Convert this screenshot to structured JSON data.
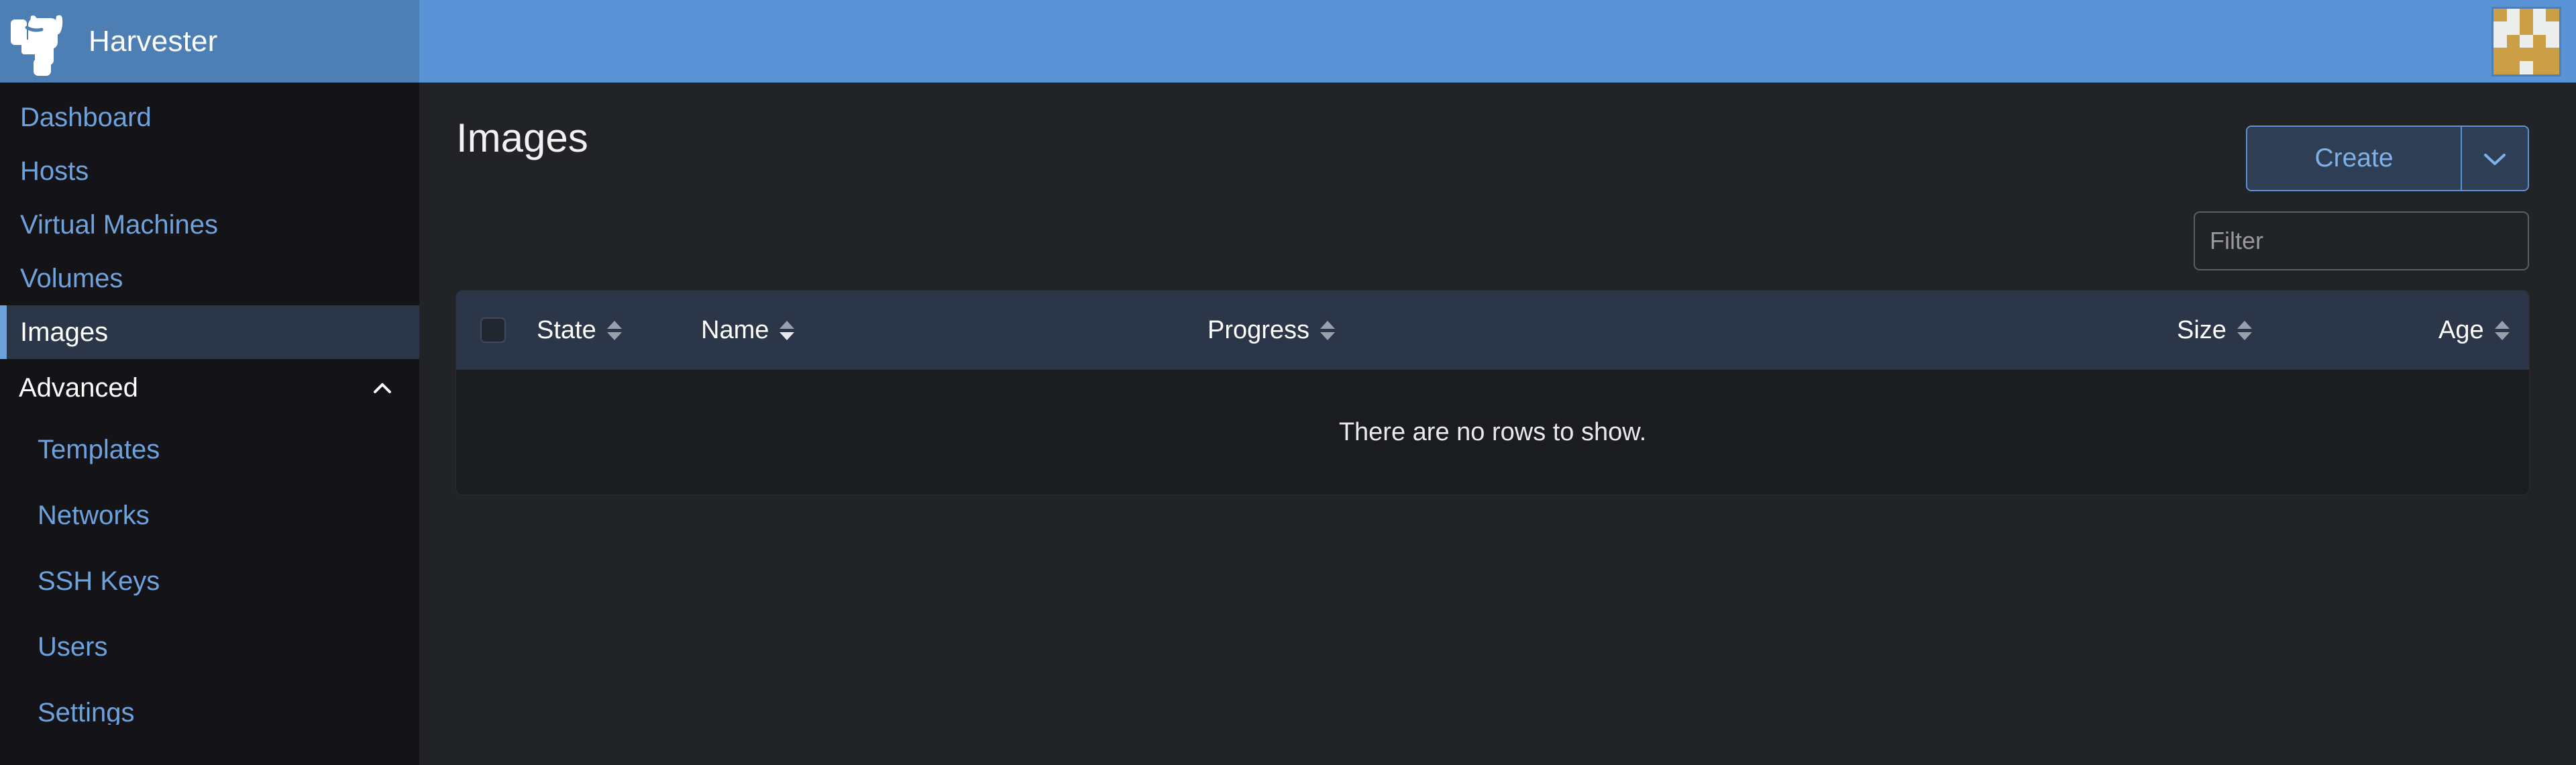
{
  "brand": {
    "title": "Harvester",
    "logo_icon": "harvester-bull-logo",
    "header_color": "#4d7fb5"
  },
  "topbar": {
    "background_color": "#5b94d6",
    "avatar_icon": "user-identicon-avatar",
    "identicon_color": "#cb9f46",
    "identicon_grid": [
      [
        1,
        0,
        1,
        0,
        1
      ],
      [
        0,
        0,
        1,
        0,
        0
      ],
      [
        0,
        1,
        0,
        1,
        0
      ],
      [
        1,
        1,
        1,
        1,
        1
      ],
      [
        1,
        1,
        0,
        1,
        1
      ]
    ]
  },
  "sidebar": {
    "items": [
      {
        "label": "Dashboard",
        "selected": false
      },
      {
        "label": "Hosts",
        "selected": false
      },
      {
        "label": "Virtual Machines",
        "selected": false
      },
      {
        "label": "Volumes",
        "selected": false
      },
      {
        "label": "Images",
        "selected": true
      }
    ],
    "group": {
      "label": "Advanced",
      "expanded": true,
      "chevron_icon": "chevron-up-icon",
      "items": [
        {
          "label": "Templates"
        },
        {
          "label": "Networks"
        },
        {
          "label": "SSH Keys"
        },
        {
          "label": "Users"
        },
        {
          "label": "Settings"
        }
      ]
    },
    "link_color": "#6ea2dd",
    "selected_bg": "#2b3748"
  },
  "main": {
    "page_title": "Images",
    "create": {
      "label": "Create",
      "dropdown_icon": "chevron-down-icon",
      "accent_color": "#5b94d6"
    },
    "filter": {
      "placeholder": "Filter",
      "value": ""
    },
    "table": {
      "select_all_icon": "checkbox-unchecked-icon",
      "columns": [
        {
          "label": "State",
          "sortable": true,
          "sorted": false,
          "sort_icon": "sort-arrows-icon"
        },
        {
          "label": "Name",
          "sortable": true,
          "sorted": true,
          "sort_direction": "desc",
          "sort_icon": "sort-arrows-icon"
        },
        {
          "label": "Progress",
          "sortable": true,
          "sorted": false,
          "sort_icon": "sort-arrows-icon"
        },
        {
          "label": "Size",
          "sortable": true,
          "sorted": false,
          "sort_icon": "sort-arrows-icon"
        },
        {
          "label": "Age",
          "sortable": true,
          "sorted": false,
          "sort_icon": "sort-arrows-icon"
        }
      ],
      "rows": [],
      "empty_message": "There are no rows to show.",
      "header_bg": "#2b3748",
      "body_bg": "#1b1c20"
    }
  }
}
